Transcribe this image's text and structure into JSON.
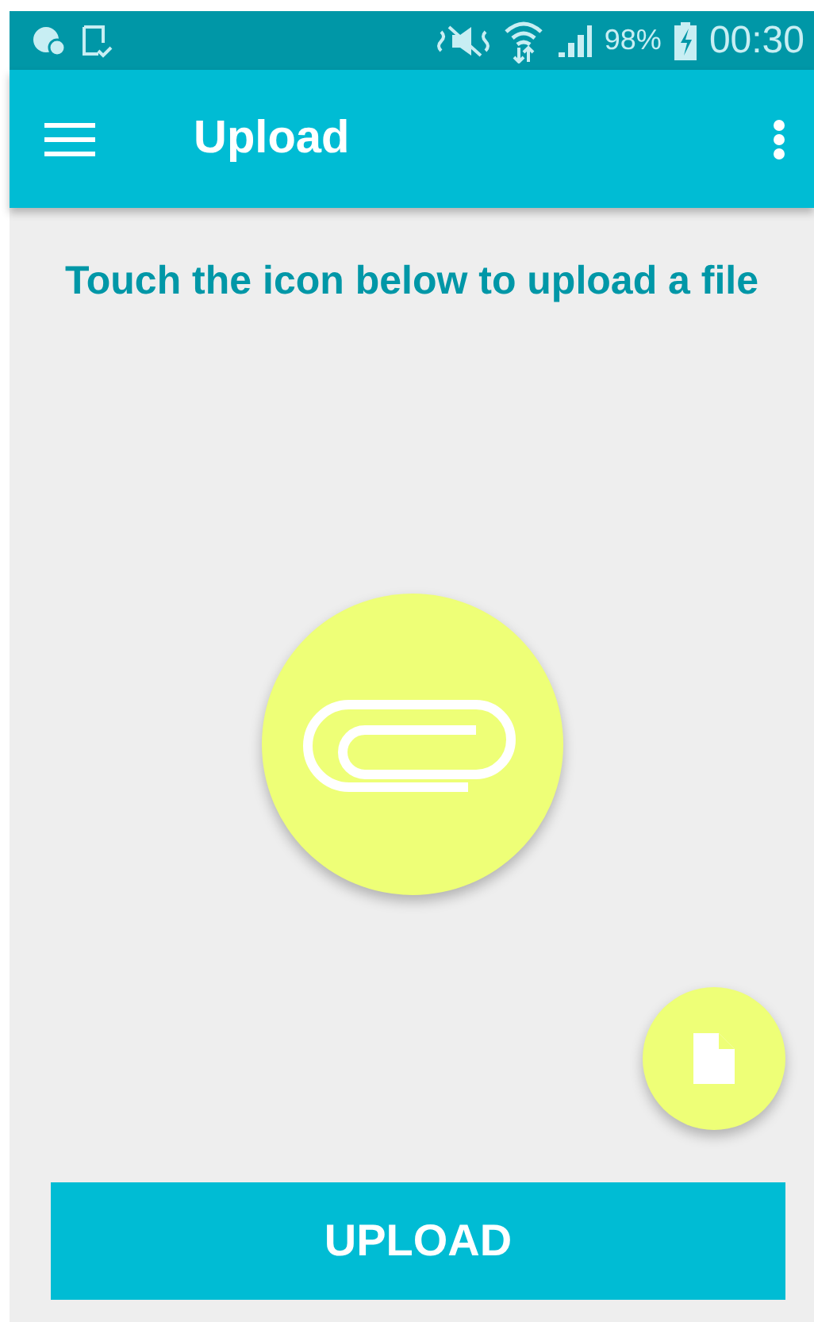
{
  "status_bar": {
    "battery": "98%",
    "time": "00:30"
  },
  "app_bar": {
    "title": "Upload"
  },
  "instruction": "Touch the icon below to upload a file",
  "upload_button": {
    "label": "UPLOAD"
  }
}
